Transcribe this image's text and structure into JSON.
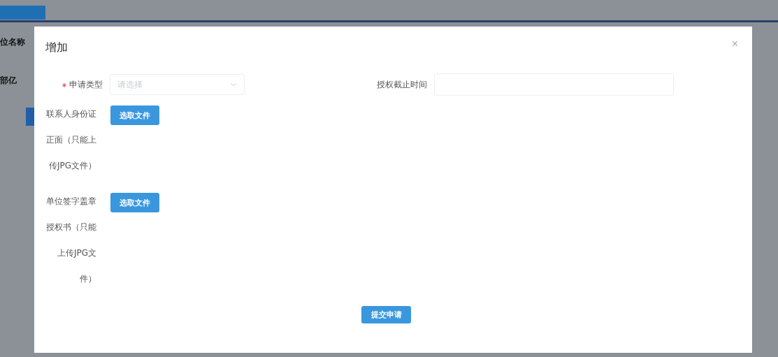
{
  "background": {
    "labels": [
      "位名称",
      "部亿"
    ]
  },
  "dialog": {
    "title": "增加",
    "close": "×",
    "fields": [
      {
        "kind": "select",
        "label": "申请类型",
        "required": true,
        "placeholder": "请选择"
      },
      {
        "kind": "input",
        "label": "授权截止时间",
        "required": false
      }
    ],
    "uploads": [
      {
        "label": "联系人身份证正面（只能上传JPG文件）",
        "button": "选取文件"
      },
      {
        "label": "单位签字盖章授权书（只能上传JPG文件）",
        "button": "选取文件"
      }
    ],
    "submit": "提交申请"
  }
}
